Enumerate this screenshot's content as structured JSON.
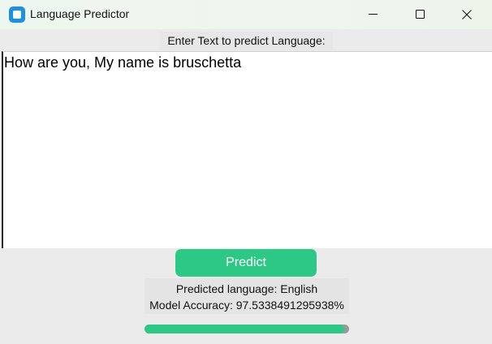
{
  "window": {
    "title": "Language Predictor",
    "icon": "app-window-icon"
  },
  "controls": {
    "minimize_icon": "minimize-icon",
    "maximize_icon": "maximize-icon",
    "close_icon": "close-icon"
  },
  "prompt": {
    "label": "Enter Text to predict Language:"
  },
  "input": {
    "value": "How are you, My name is bruschetta"
  },
  "predict_button": {
    "label": "Predict"
  },
  "result": {
    "language_line": "Predicted language: English",
    "accuracy_line": "Model Accuracy: 97.5338491295938%"
  },
  "progress": {
    "fraction": 0.975338491295938
  },
  "colors": {
    "accent": "#2dc885",
    "progress_track": "#9a9a9a",
    "app_icon": "#1f8fe0",
    "window_background": "#ebebeb"
  }
}
